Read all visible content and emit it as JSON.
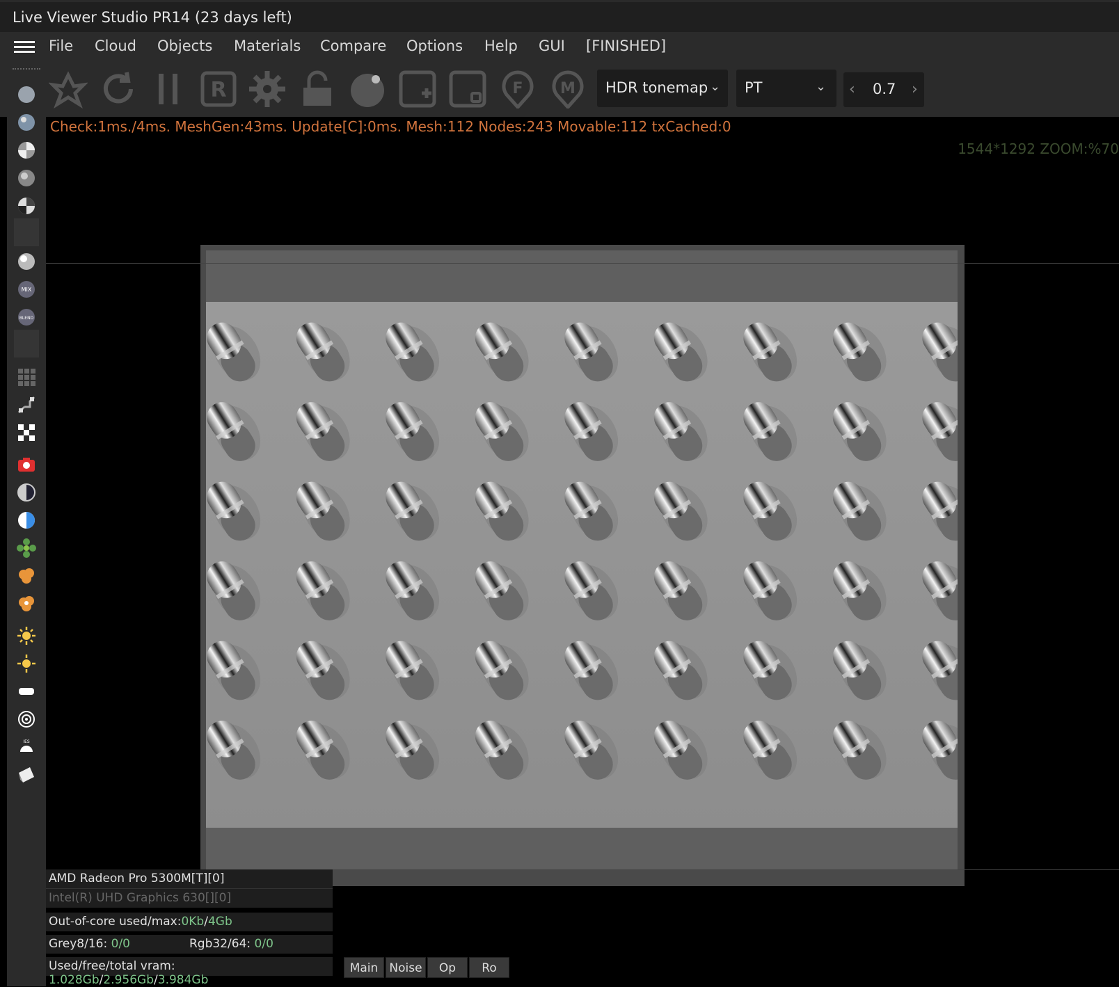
{
  "window": {
    "title": "Live Viewer Studio PR14 (23 days left)"
  },
  "menu": {
    "items": [
      "File",
      "Cloud",
      "Objects",
      "Materials",
      "Compare",
      "Options",
      "Help",
      "GUI"
    ],
    "status": "[FINISHED]"
  },
  "toolbar": {
    "icons": [
      "recenter-icon",
      "reset-icon",
      "pause-icon",
      "region-icon",
      "settings-gear-icon",
      "lock-icon",
      "material-picker-icon",
      "add-icon",
      "render-region-icon",
      "focus-pick-icon",
      "material-pick-icon"
    ],
    "tonemap_select": "HDR tonemap",
    "kernel_select": "PT",
    "exposure_value": "0.7"
  },
  "viewport": {
    "stats": "Check:1ms./4ms. MeshGen:43ms. Update[C]:0ms. Mesh:112 Nodes:243 Movable:112 txCached:0",
    "resolution_zoom": "1544*1292 ZOOM:%70"
  },
  "info": {
    "gpu1": "AMD Radeon Pro 5300M[T][0]",
    "gpu2": "Intel(R) UHD Graphics 630[][0]",
    "ooc_label": "Out-of-core used/max:",
    "ooc_used": "0Kb",
    "ooc_sep": "/",
    "ooc_max": "4Gb",
    "grey_label": "Grey8/16: ",
    "grey_value": "0/0",
    "rgb_label": "Rgb32/64: ",
    "rgb_value": "0/0",
    "vram_label": "Used/free/total vram: ",
    "vram_used": "1.028Gb",
    "vram_sep1": "/",
    "vram_free": "2.956Gb",
    "vram_sep2": "/",
    "vram_total": "3.984Gb"
  },
  "tabs": [
    "Main",
    "Noise",
    "Op",
    "Ro"
  ],
  "colors": {
    "stats": "#d2743d",
    "value_green": "#7ec48a",
    "panel_bg": "#2b2b2b"
  }
}
